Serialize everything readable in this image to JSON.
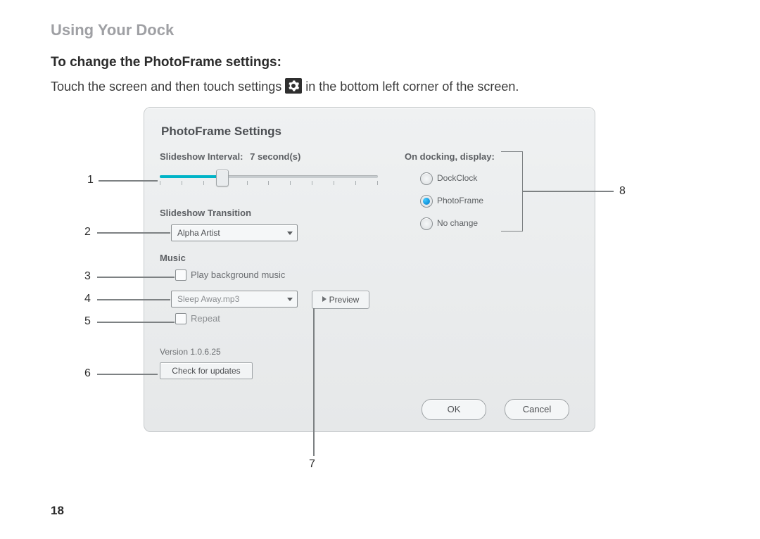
{
  "page": {
    "heading": "Using Your Dock",
    "subheading": "To change the PhotoFrame settings:",
    "body_before": "Touch the screen and then touch settings",
    "body_after": "in the bottom left corner of the screen.",
    "page_number": "18"
  },
  "dialog": {
    "title": "PhotoFrame Settings",
    "interval_label": "Slideshow Interval:",
    "interval_value": "7 second(s)",
    "transition_label": "Slideshow Transition",
    "transition_value": "Alpha Artist",
    "music_label": "Music",
    "play_bg_music": "Play background music",
    "music_file": "Sleep Away.mp3",
    "preview": "Preview",
    "repeat": "Repeat",
    "version": "Version 1.0.6.25",
    "check_updates": "Check for updates",
    "docking_label": "On docking, display:",
    "radio1": "DockClock",
    "radio2": "PhotoFrame",
    "radio3": "No change",
    "ok": "OK",
    "cancel": "Cancel"
  },
  "callouts": {
    "c1": "1",
    "c2": "2",
    "c3": "3",
    "c4": "4",
    "c5": "5",
    "c6": "6",
    "c7": "7",
    "c8": "8"
  }
}
